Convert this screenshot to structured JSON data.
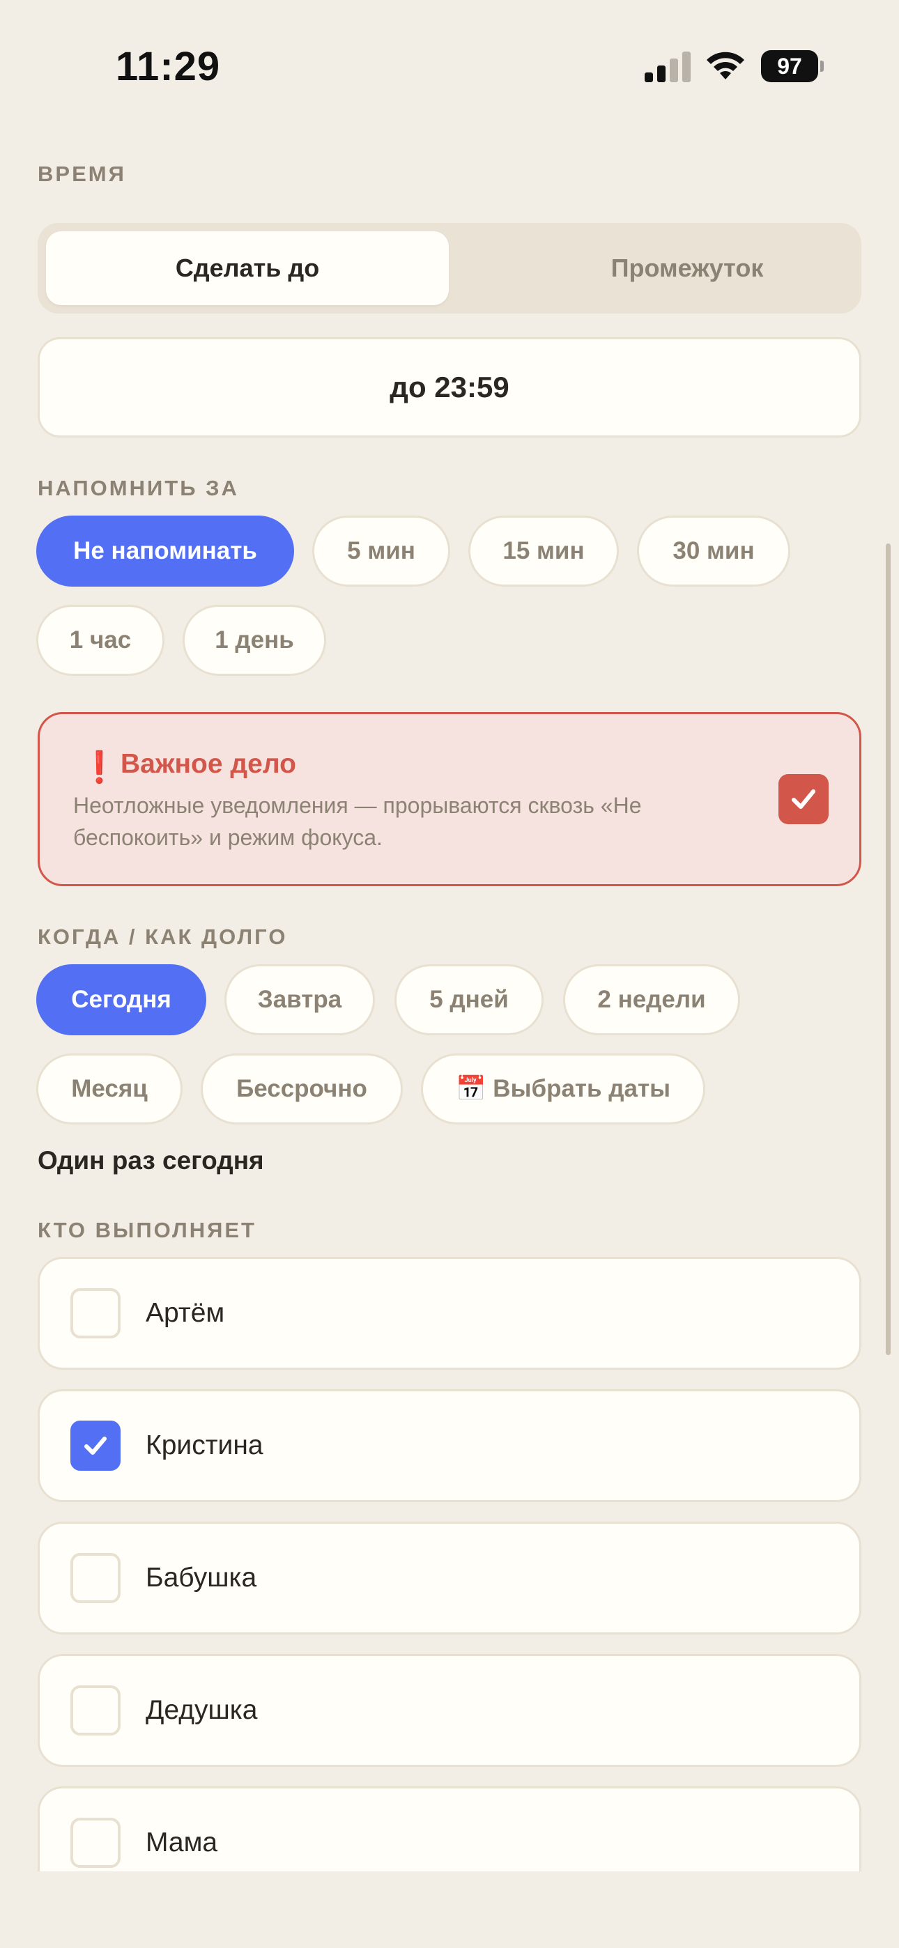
{
  "status": {
    "time": "11:29",
    "battery": "97"
  },
  "time_section": {
    "label": "ВРЕМЯ",
    "tabs": [
      "Сделать до",
      "Промежуток"
    ],
    "value": "до 23:59"
  },
  "remind": {
    "label": "НАПОМНИТЬ ЗА",
    "options": [
      "Не напоминать",
      "5 мин",
      "15 мин",
      "30 мин",
      "1 час",
      "1 день"
    ],
    "selected": "Не напоминать"
  },
  "important": {
    "icon": "❗",
    "title": "Важное дело",
    "description": "Неотложные уведомления — прорываются сквозь «Не беспокоить» и режим фокуса.",
    "checked": true
  },
  "when": {
    "label": "КОГДА / КАК ДОЛГО",
    "options": [
      "Сегодня",
      "Завтра",
      "5 дней",
      "2 недели",
      "Месяц",
      "Бессрочно",
      "📅 Выбрать даты"
    ],
    "selected": "Сегодня",
    "summary": "Один раз сегодня"
  },
  "assignees": {
    "label": "КТО ВЫПОЛНЯЕТ",
    "people": [
      {
        "name": "Артём",
        "checked": false
      },
      {
        "name": "Кристина",
        "checked": true
      },
      {
        "name": "Бабушка",
        "checked": false
      },
      {
        "name": "Дедушка",
        "checked": false
      },
      {
        "name": "Мама",
        "checked": false
      }
    ]
  },
  "colors": {
    "accent": "#5370F5",
    "important": "#D2564A",
    "background": "#F3EEE5"
  }
}
